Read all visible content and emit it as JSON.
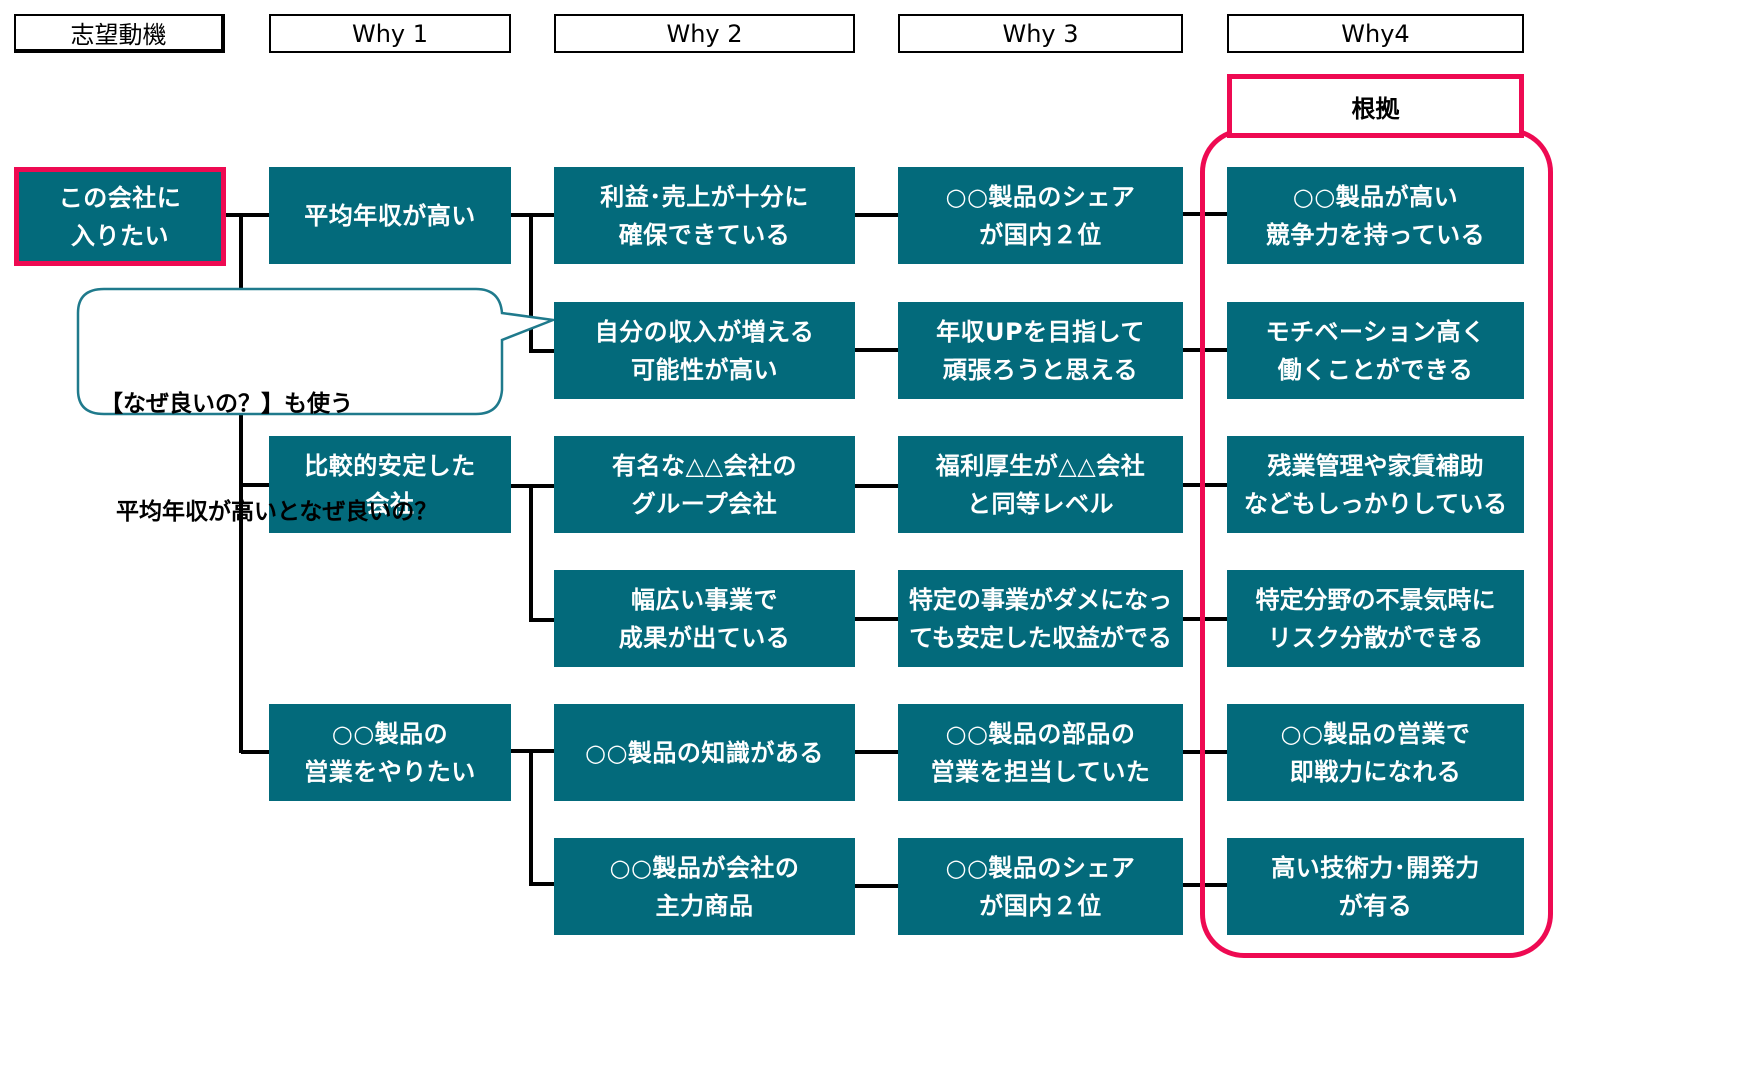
{
  "headers": {
    "motive": "志望動機",
    "why1": "Why 1",
    "why2": "Why 2",
    "why3": "Why 3",
    "why4": "Why4"
  },
  "evidence_label": "根拠",
  "root": "この会社に\n入りたい",
  "why1": [
    "平均年収が高い",
    "比較的安定した\n会社",
    "○○製品の\n営業をやりたい"
  ],
  "why2": [
    "利益･売上が十分に\n確保できている",
    "自分の収入が増える\n可能性が高い",
    "有名な△△会社の\nグループ会社",
    "幅広い事業で\n成果が出ている",
    "○○製品の知識がある",
    "○○製品が会社の\n主力商品"
  ],
  "why3": [
    "○○製品のシェア\nが国内２位",
    "年収UPを目指して\n頑張ろうと思える",
    "福利厚生が△△会社\nと同等レベル",
    "特定の事業がダメになっ\nても安定した収益がでる",
    "○○製品の部品の\n営業を担当していた",
    "○○製品のシェア\nが国内２位"
  ],
  "why4": [
    "○○製品が高い\n競争力を持っている",
    "モチベーション高く\n働くことができる",
    "残業管理や家賃補助\nなどもしっかりしている",
    "特定分野の不景気時に\nリスク分散ができる",
    "○○製品の営業で\n即戦力になれる",
    "高い技術力･開発力\nが有る"
  ],
  "callout": {
    "line1": "【なぜ良いの？】も使う",
    "line2": "  平均年収が高いとなぜ良いの？"
  },
  "colors": {
    "node_fill": "#036a7b",
    "highlight": "#ee0a52",
    "callout_border": "#1f7a8c"
  }
}
